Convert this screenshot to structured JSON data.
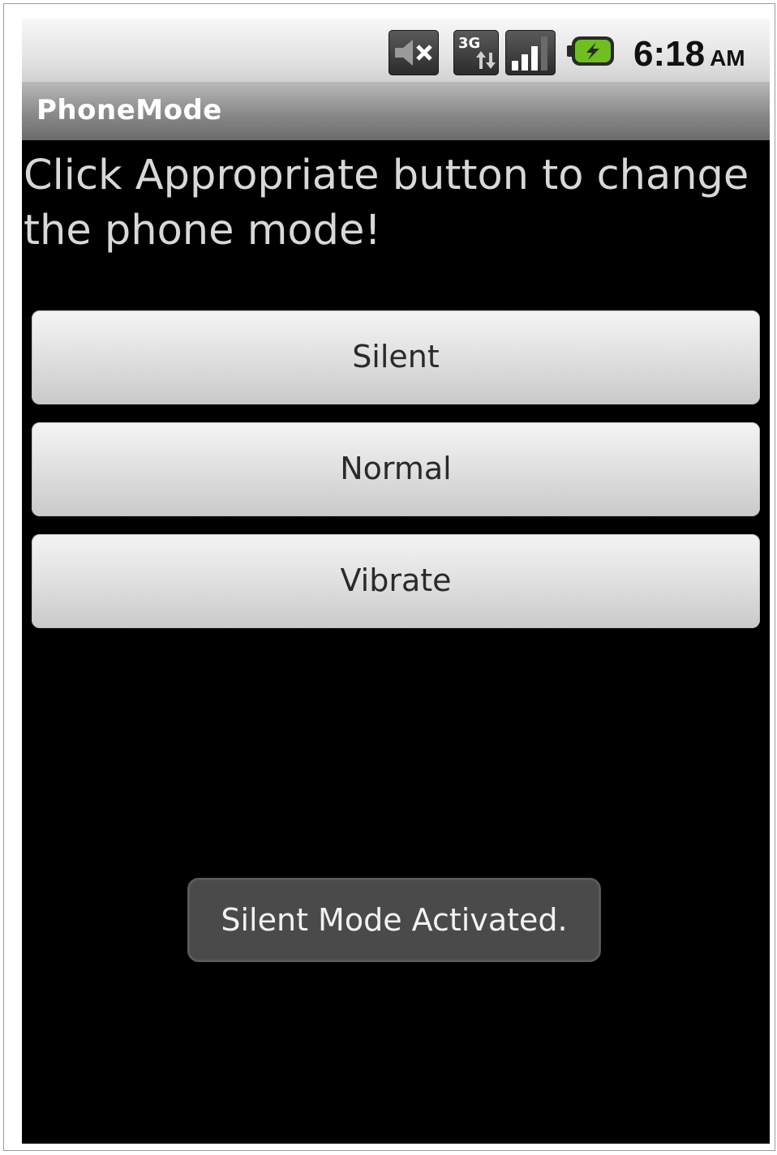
{
  "status_bar": {
    "icons": [
      "volume-muted-icon",
      "3g-data-icon",
      "signal-strength-icon",
      "battery-charging-icon"
    ],
    "network_label": "3G",
    "time": "6:18",
    "ampm": "AM"
  },
  "app": {
    "title": "PhoneMode"
  },
  "main": {
    "instruction": "Click Appropriate button to change the phone mode!",
    "buttons": {
      "silent": "Silent",
      "normal": "Normal",
      "vibrate": "Vibrate"
    }
  },
  "toast": {
    "message": "Silent Mode Activated."
  },
  "colors": {
    "background": "#000000",
    "battery_accent": "#6fbf1f",
    "toast_bg": "#4a4a4a"
  }
}
